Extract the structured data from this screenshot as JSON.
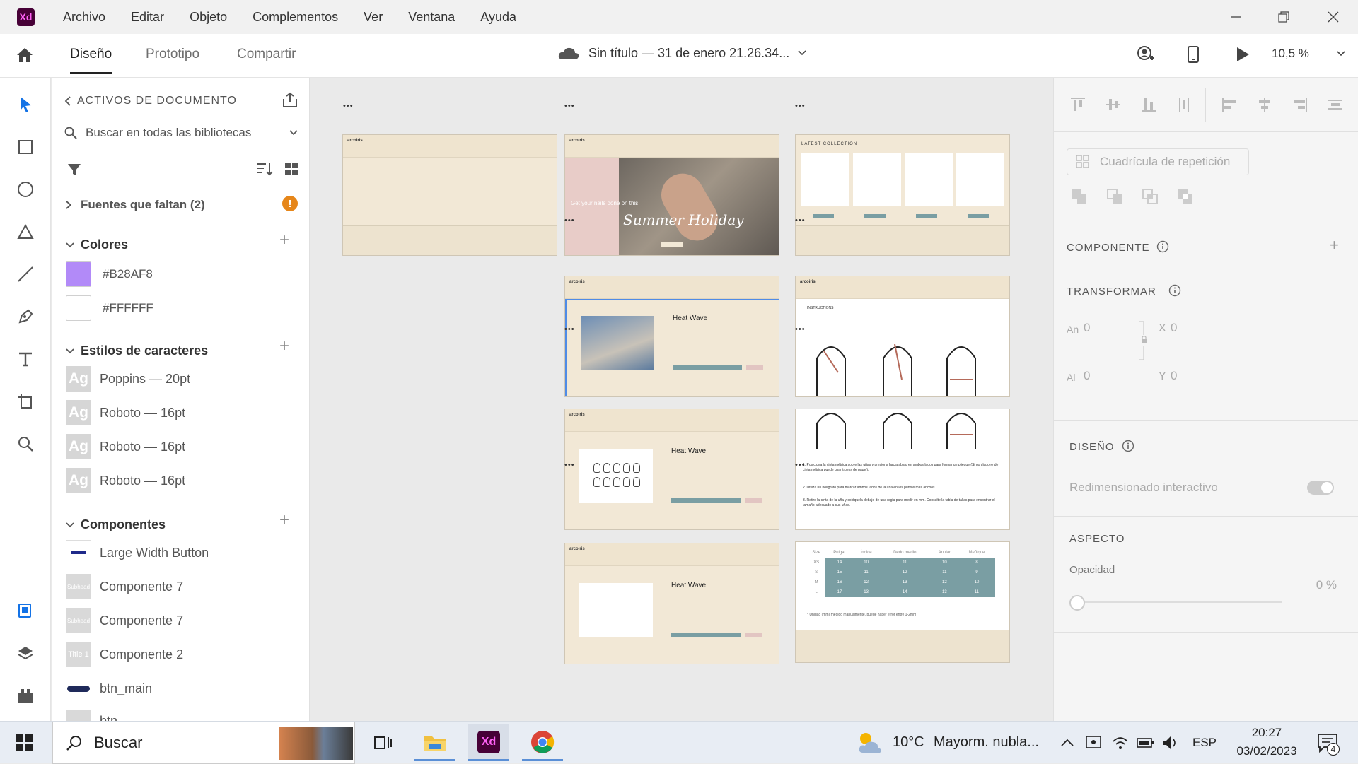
{
  "titlebar": {
    "app_logo": "Xd",
    "menu": [
      "Archivo",
      "Editar",
      "Objeto",
      "Complementos",
      "Ver",
      "Ventana",
      "Ayuda"
    ]
  },
  "toolbar": {
    "tabs": [
      "Diseño",
      "Prototipo",
      "Compartir"
    ],
    "document_title": "Sin título — 31 de enero 21.26.34...",
    "zoom": "10,5 %"
  },
  "assets": {
    "header": "ACTIVOS DE DOCUMENTO",
    "search_placeholder": "Buscar en todas las bibliotecas",
    "missing_fonts": "Fuentes que faltan (2)",
    "colors_title": "Colores",
    "colors": [
      {
        "hex": "#B28AF8",
        "label": "#B28AF8"
      },
      {
        "hex": "#FFFFFF",
        "label": "#FFFFFF"
      }
    ],
    "char_styles_title": "Estilos de caracteres",
    "char_styles": [
      {
        "thumb": "Ag",
        "label": "Poppins — 20pt"
      },
      {
        "thumb": "Ag",
        "label": "Roboto — 16pt"
      },
      {
        "thumb": "Ag",
        "label": "Roboto — 16pt"
      },
      {
        "thumb": "Ag",
        "label": "Roboto — 16pt"
      }
    ],
    "components_title": "Componentes",
    "components": [
      {
        "thumb": "",
        "label": "Large Width Button"
      },
      {
        "thumb": "Subhead",
        "label": "Componente 7"
      },
      {
        "thumb": "Subhead",
        "label": "Componente 7"
      },
      {
        "thumb": "Title 1",
        "label": "Componente 2"
      },
      {
        "thumb": "",
        "label": "btn_main"
      },
      {
        "thumb": "",
        "label": "btn"
      }
    ]
  },
  "canvas": {
    "brand": "arcoiris",
    "hero_text": "Get your nails done on this",
    "hero_script": "Summer Holiday",
    "collection_title": "LATEST COLLECTION",
    "product_title": "Heat Wave",
    "instructions_title": "INSTRUCTIONS",
    "instructions_steps": [
      "1. Posiciona la cinta métrica sobre las uñas y presiona hacia abajo en ambos lados para formar un pliegue (Si no dispone de cinta métrica puede usar trozos de papel).",
      "2. Utiliza un bolígrafo para marcar ambos lados de la uña en los puntos más anchos.",
      "3. Retire la cinta de la uña y colóquela debajo de una regla para medir en mm. Consulte la tabla de tallas para encontrar el tamaño adecuado a sus uñas."
    ],
    "size_table": {
      "headers": [
        "Size",
        "Pulgar",
        "Índice",
        "Dedo medio",
        "Anular",
        "Meñique"
      ],
      "rows": [
        [
          "XS",
          "14",
          "10",
          "11",
          "10",
          "8"
        ],
        [
          "S",
          "15",
          "11",
          "12",
          "11",
          "9"
        ],
        [
          "M",
          "16",
          "12",
          "13",
          "12",
          "10"
        ],
        [
          "L",
          "17",
          "13",
          "14",
          "13",
          "11"
        ]
      ],
      "note": "* Unidad (mm) medido manualmente, puede haber error entre 1-2mm"
    }
  },
  "right_panel": {
    "repeat_grid": "Cuadrícula de repetición",
    "component_title": "COMPONENTE",
    "transform_title": "TRANSFORMAR",
    "width_label": "An",
    "width_value": "0",
    "height_label": "Al",
    "height_value": "0",
    "x_label": "X",
    "x_value": "0",
    "y_label": "Y",
    "y_value": "0",
    "design_title": "DISEÑO",
    "responsive_resize": "Redimensionado interactivo",
    "aspect_title": "ASPECTO",
    "opacity_label": "Opacidad",
    "opacity_value": "0 %",
    "opacity_level": 0
  },
  "taskbar": {
    "search_placeholder": "Buscar",
    "weather_temp": "10°C",
    "weather_desc": "Mayorm. nubla...",
    "language": "ESP",
    "time": "20:27",
    "date": "03/02/2023",
    "notification_count": "4"
  },
  "colors": {
    "accent_blue": "#1473e6",
    "xd_purple": "#470137",
    "xd_pink": "#ff61f6",
    "teal": "#7a9ea3",
    "cream": "#f2e8d6"
  }
}
